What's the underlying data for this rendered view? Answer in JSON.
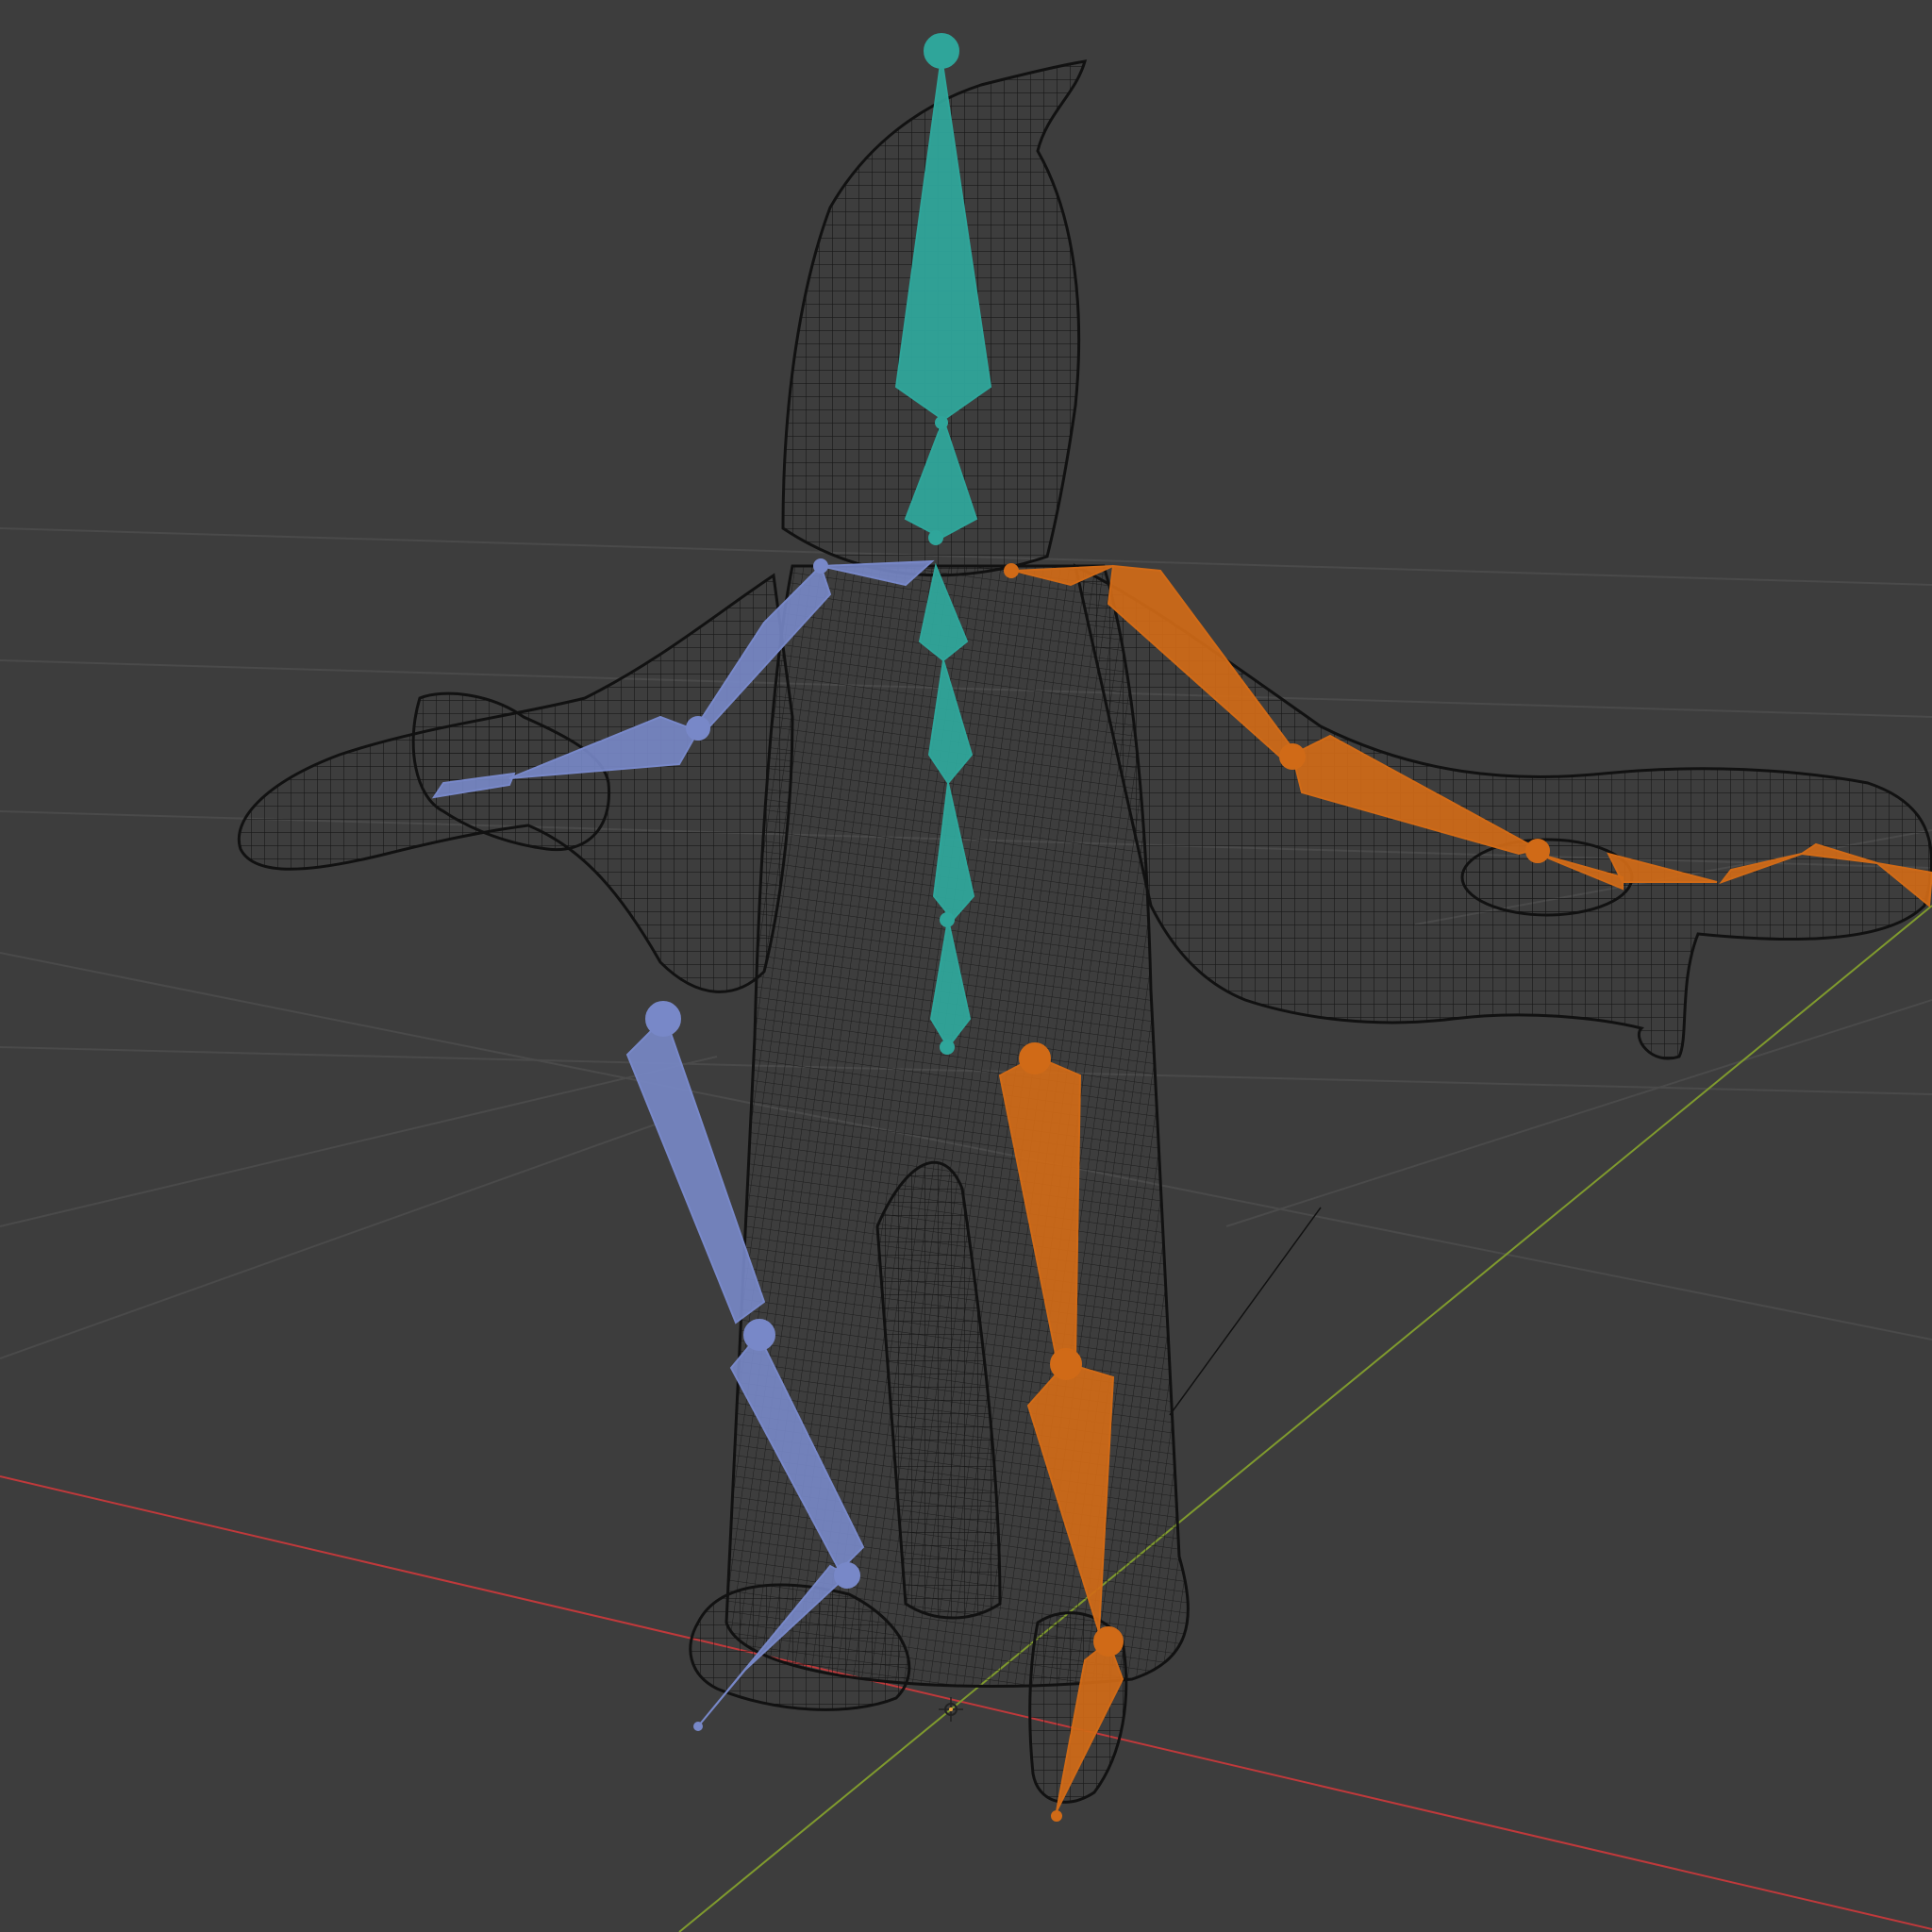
{
  "viewport": {
    "background": "#3d3d3d",
    "grid_color": "#4a4a4a",
    "x_axis_color": "#c0393b",
    "y_axis_color": "#7f9a2e",
    "mesh_color": "#111111"
  },
  "armature": {
    "spine_color": "#2fa59a",
    "left_side_color": "#7888c8",
    "right_side_color": "#d06a17"
  }
}
